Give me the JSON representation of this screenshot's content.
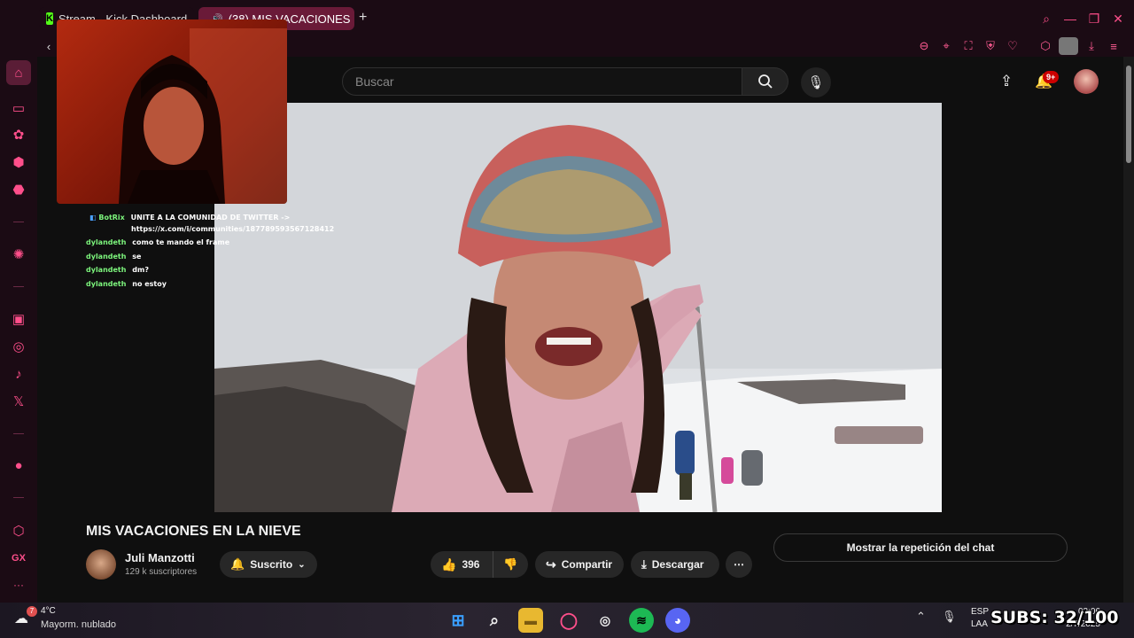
{
  "browser": {
    "tabs": [
      {
        "label": "Stream - Kick Dashboard",
        "active": false
      },
      {
        "label": "(38) MIS VACACIONES",
        "active": true
      }
    ],
    "new_tab": "+",
    "sidebar_gx_label": "GX",
    "sidebar_more": "···"
  },
  "youtube": {
    "search_placeholder": "Buscar",
    "notifications_badge": "9+",
    "video": {
      "title": "MIS VACACIONES EN LA NIEVE",
      "channel_name": "Juli Manzotti",
      "subscribers": "129 k suscriptores",
      "subscribed_label": "Suscrito",
      "likes": "396",
      "share_label": "Compartir",
      "download_label": "Descargar",
      "show_chat_label": "Mostrar la repetición del chat"
    }
  },
  "stream_chat": [
    {
      "user": "BotRix",
      "message": "UNITE A LA COMUNIDAD DE TWITTER ->"
    },
    {
      "user": "",
      "message": "https://x.com/i/communities/1877895935671284​12"
    },
    {
      "user": "dylandeth",
      "message": "como te mando el frame"
    },
    {
      "user": "dylandeth",
      "message": "se"
    },
    {
      "user": "dylandeth",
      "message": "dm?"
    },
    {
      "user": "dylandeth",
      "message": "no estoy"
    }
  ],
  "overlay": {
    "subs": "SUBS: 32/100"
  },
  "taskbar": {
    "weather_temp": "4°C",
    "weather_desc": "Mayorm. nublado",
    "weather_badge": "7",
    "lang_top": "ESP",
    "lang_bottom": "LAA",
    "time": "03:06",
    "date": "2/7/2025"
  },
  "colors": {
    "opera_accent": "#ff4f8b",
    "browser_bg": "#1b0b14",
    "youtube_bg": "#0f0f0f",
    "chat_username": "#7cf47c"
  }
}
